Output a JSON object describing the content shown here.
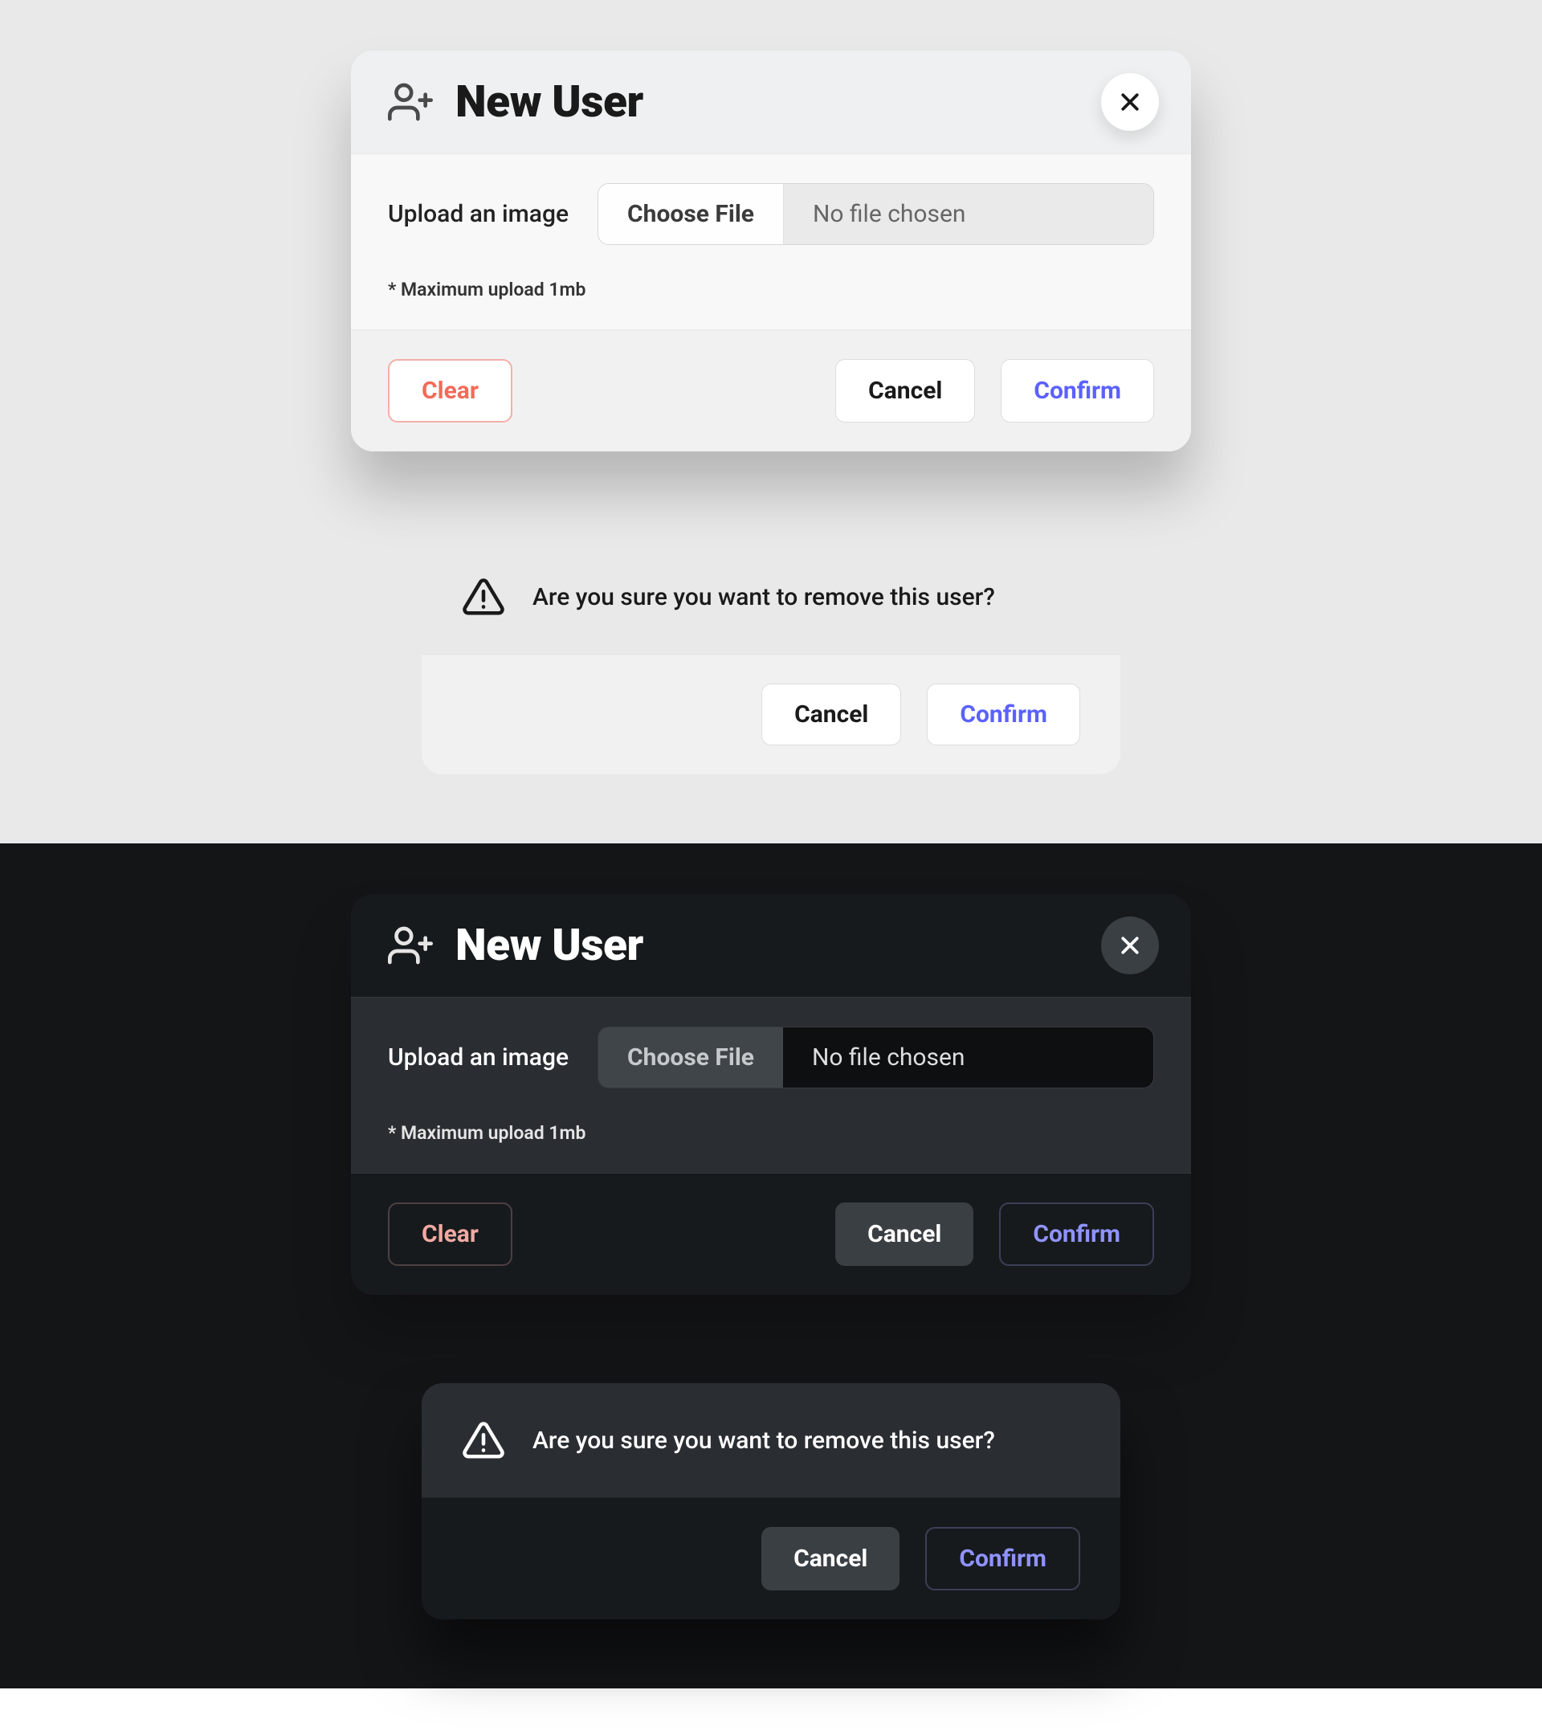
{
  "modal": {
    "title": "New User",
    "upload_label": "Upload an image",
    "choose_file": "Choose File",
    "no_file": "No file chosen",
    "max_note": "* Maximum upload 1mb",
    "clear": "Clear",
    "cancel": "Cancel",
    "confirm": "Confirm"
  },
  "alert": {
    "text": "Are you sure you want to remove this user?",
    "cancel": "Cancel",
    "confirm": "Confirm"
  },
  "colors": {
    "accent_confirm_light": "#5b61ff",
    "accent_clear_light": "#f36a5a",
    "accent_confirm_dark": "#8f93ff",
    "accent_clear_dark": "#f2a9a3",
    "bg_light": "#e9e9e9",
    "bg_dark": "#141517"
  }
}
